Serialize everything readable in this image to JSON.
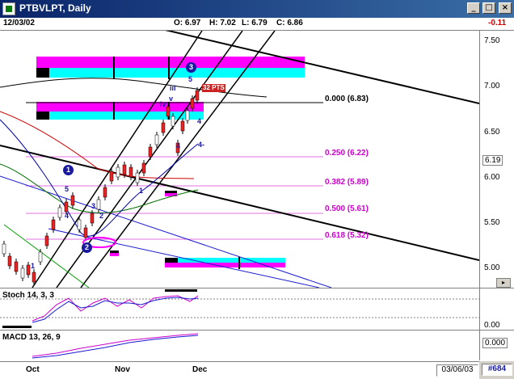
{
  "window": {
    "title": "PTBVLPT, Daily",
    "minimize": "_",
    "maximize": "□",
    "close": "×"
  },
  "info": {
    "date": "12/03/02",
    "open": "O: 6.97",
    "high": "H: 7.02",
    "low": "L: 6.79",
    "close": "C: 6.86",
    "change": "-0.11"
  },
  "price_axis": {
    "ticks": [
      "7.50",
      "7.00",
      "6.50",
      "6.19",
      "6.00",
      "5.50",
      "5.00"
    ],
    "current": "6.19"
  },
  "fib_levels": [
    {
      "label": "0.000 (6.83)",
      "color": "#000000"
    },
    {
      "label": "0.250 (6.22)",
      "color": "#cc00cc"
    },
    {
      "label": "0.382 (5.89)",
      "color": "#cc00cc"
    },
    {
      "label": "0.500 (5.61)",
      "color": "#cc00cc"
    },
    {
      "label": "0.618 (5.32)",
      "color": "#cc00cc"
    }
  ],
  "pattern_labels": {
    "price_tag": "32 PTS"
  },
  "markers": [
    "1",
    "2",
    "3"
  ],
  "wave_labels": [
    "5",
    "4",
    "3",
    "2",
    "1",
    "v",
    "iv",
    "iii",
    "5",
    "4",
    "4-",
    "3"
  ],
  "stoch": {
    "title": "Stoch 14, 3, 3",
    "axis": "0.00"
  },
  "macd": {
    "title": "MACD 13, 26, 9",
    "axis": "0.000"
  },
  "time_axis": {
    "labels": [
      "Oct",
      "Nov",
      "Dec"
    ],
    "end_date": "03/06/03",
    "bar_number": "#684"
  },
  "colors": {
    "magenta_band": "#ff00ff",
    "cyan_band": "#00ffff",
    "fib": "#cc00cc",
    "marker": "#1a1aa0"
  }
}
